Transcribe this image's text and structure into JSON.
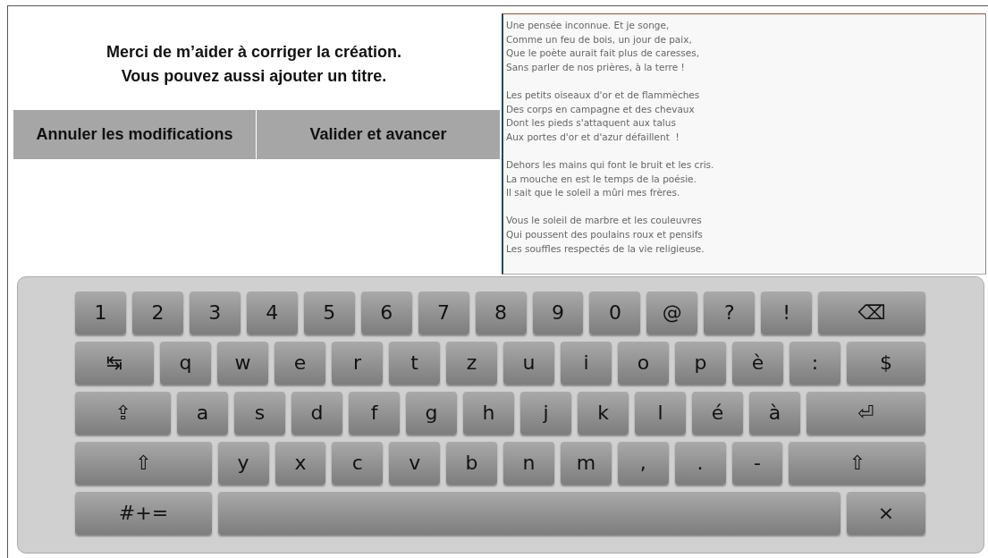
{
  "heading": [
    "Merci de m’aider à corriger la création.",
    "Vous pouvez aussi ajouter un titre."
  ],
  "buttons": [
    "Annuler les modifications",
    "Valider et avancer"
  ],
  "editor": {
    "stanzas": [
      [
        "Une pensée inconnue. Et je songe,",
        "Comme un feu de bois, un jour de paix,",
        "Que le poète aurait fait plus de caresses,",
        "Sans parler de nos prières, à la terre !"
      ],
      [
        "Les petits oiseaux d'or et de flammèches",
        "Des corps en campagne et des chevaux",
        "Dont les pieds s'attaquent aux talus",
        "Aux portes d'or et d'azur défaillent  !"
      ],
      [
        "Dehors les mains qui font le bruit et les cris.",
        "La mouche en est le temps de la poésie.",
        "Il sait que le soleil a mûri mes frères."
      ],
      [
        "Vous le soleil de marbre et les couleuvres",
        "Qui poussent des poulains roux et pensifs",
        "Les souffles respectés de la vie religieuse."
      ]
    ]
  },
  "keyboard": {
    "rows": [
      [
        {
          "label": "1",
          "kind": "char"
        },
        {
          "label": "2",
          "kind": "char"
        },
        {
          "label": "3",
          "kind": "char"
        },
        {
          "label": "4",
          "kind": "char"
        },
        {
          "label": "5",
          "kind": "char"
        },
        {
          "label": "6",
          "kind": "char"
        },
        {
          "label": "7",
          "kind": "char"
        },
        {
          "label": "8",
          "kind": "char"
        },
        {
          "label": "9",
          "kind": "char"
        },
        {
          "label": "0",
          "kind": "char"
        },
        {
          "label": "@",
          "kind": "char"
        },
        {
          "label": "?",
          "kind": "char"
        },
        {
          "label": "!",
          "kind": "char"
        },
        {
          "label": "⌫",
          "kind": "backspace"
        }
      ],
      [
        {
          "label": "↹",
          "kind": "tab"
        },
        {
          "label": "q",
          "kind": "char"
        },
        {
          "label": "w",
          "kind": "char"
        },
        {
          "label": "e",
          "kind": "char"
        },
        {
          "label": "r",
          "kind": "char"
        },
        {
          "label": "t",
          "kind": "char"
        },
        {
          "label": "z",
          "kind": "char"
        },
        {
          "label": "u",
          "kind": "char"
        },
        {
          "label": "i",
          "kind": "char"
        },
        {
          "label": "o",
          "kind": "char"
        },
        {
          "label": "p",
          "kind": "char"
        },
        {
          "label": "è",
          "kind": "char"
        },
        {
          "label": ":",
          "kind": "char"
        },
        {
          "label": "$",
          "kind": "tab"
        }
      ],
      [
        {
          "label": "⇪",
          "kind": "caps"
        },
        {
          "label": "a",
          "kind": "char"
        },
        {
          "label": "s",
          "kind": "char"
        },
        {
          "label": "d",
          "kind": "char"
        },
        {
          "label": "f",
          "kind": "char"
        },
        {
          "label": "g",
          "kind": "char"
        },
        {
          "label": "h",
          "kind": "char"
        },
        {
          "label": "j",
          "kind": "char"
        },
        {
          "label": "k",
          "kind": "char"
        },
        {
          "label": "l",
          "kind": "char"
        },
        {
          "label": "é",
          "kind": "char"
        },
        {
          "label": "à",
          "kind": "char"
        },
        {
          "label": "⏎",
          "kind": "enter"
        }
      ],
      [
        {
          "label": "⇧",
          "kind": "shift"
        },
        {
          "label": "y",
          "kind": "char"
        },
        {
          "label": "x",
          "kind": "char"
        },
        {
          "label": "c",
          "kind": "char"
        },
        {
          "label": "v",
          "kind": "char"
        },
        {
          "label": "b",
          "kind": "char"
        },
        {
          "label": "n",
          "kind": "char"
        },
        {
          "label": "m",
          "kind": "char"
        },
        {
          "label": ",",
          "kind": "char"
        },
        {
          "label": ".",
          "kind": "char"
        },
        {
          "label": "-",
          "kind": "char"
        },
        {
          "label": "⇧",
          "kind": "shift"
        }
      ],
      [
        {
          "label": "#+=",
          "kind": "shift"
        },
        {
          "kind": "space"
        },
        {
          "label": "×",
          "kind": "tab"
        }
      ]
    ]
  }
}
